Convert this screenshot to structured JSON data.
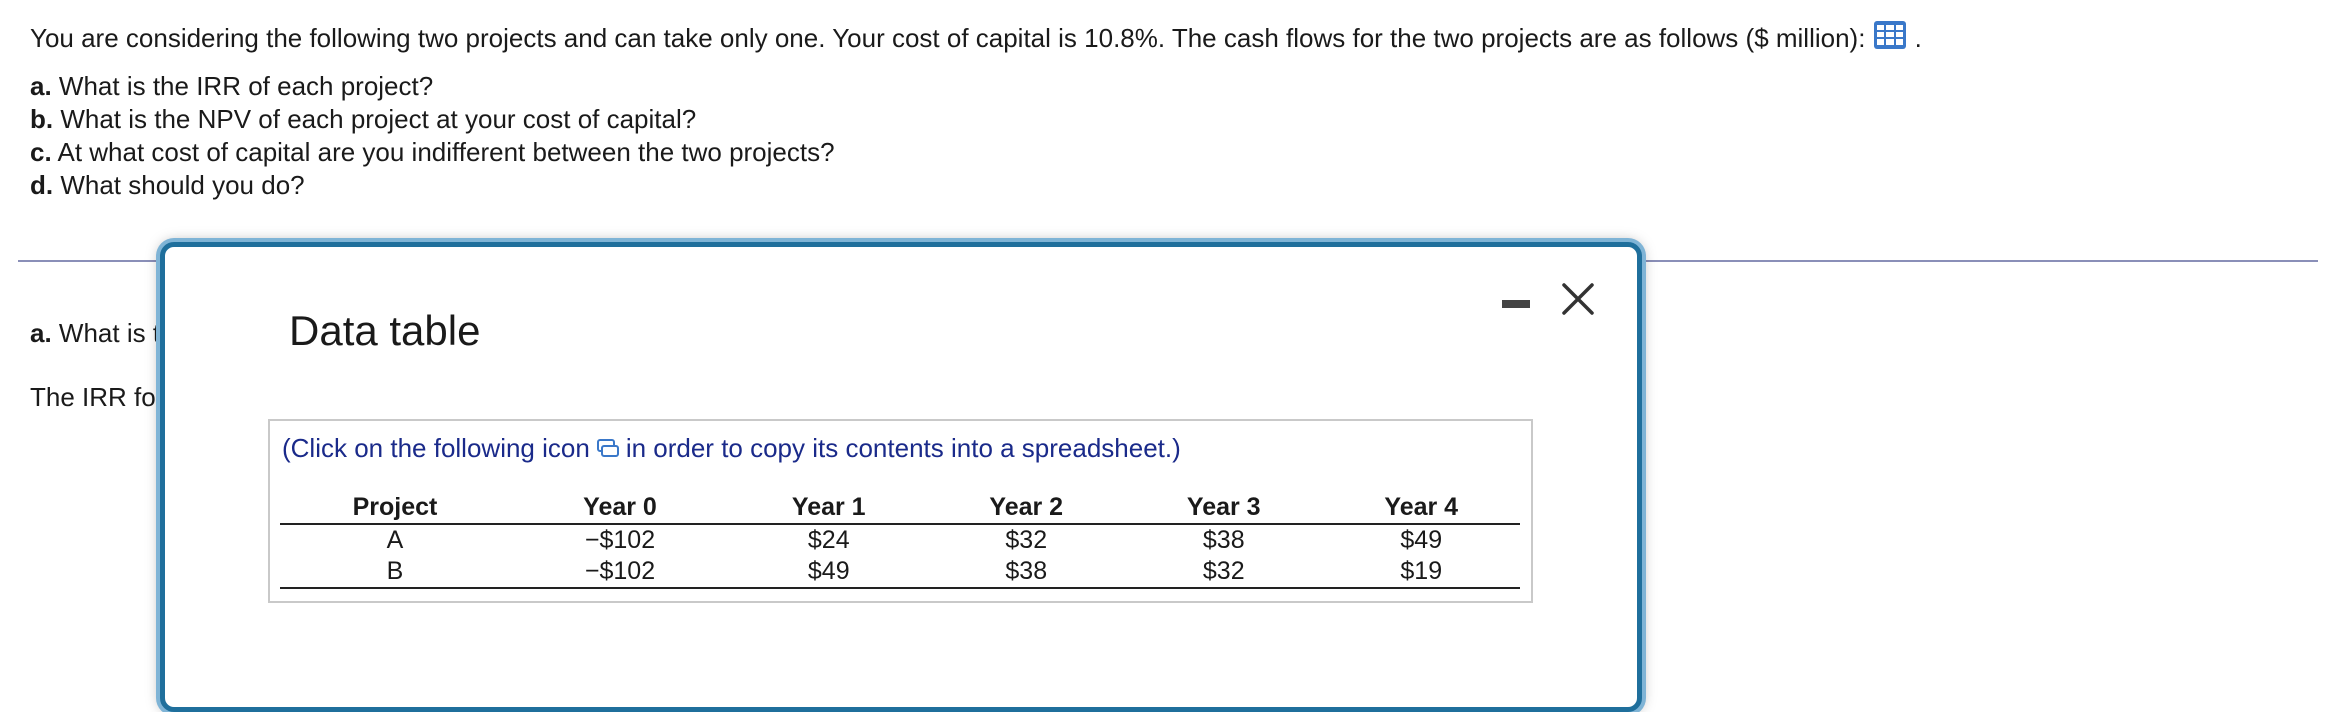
{
  "question": {
    "intro": "You are considering the following two projects and can take only one. Your cost of capital is 10.8%. The cash flows for the two projects are as follows ($ million):",
    "intro_end": ".",
    "parts": [
      {
        "letter": "a.",
        "text": "What is the IRR of each project?"
      },
      {
        "letter": "b.",
        "text": "What is the NPV of each project at your cost of capital?"
      },
      {
        "letter": "c.",
        "text": "At what cost of capital are you indifferent between the two projects?"
      },
      {
        "letter": "d.",
        "text": "What should you do?"
      }
    ]
  },
  "behind": {
    "part_a_letter": "a.",
    "part_a_text": "What is t",
    "irr_text": "The IRR fo"
  },
  "modal": {
    "title": "Data table",
    "copy_note_prefix": "(Click on the following icon",
    "copy_note_suffix": "in order to copy its contents into a spreadsheet.)",
    "table": {
      "headers": [
        "Project",
        "Year 0",
        "Year 1",
        "Year 2",
        "Year 3",
        "Year 4"
      ],
      "rows": [
        [
          "A",
          "−$102",
          "$24",
          "$32",
          "$38",
          "$49"
        ],
        [
          "B",
          "−$102",
          "$49",
          "$38",
          "$32",
          "$19"
        ]
      ]
    }
  },
  "colors": {
    "modal_border": "#1f6f9c",
    "link_text": "#1a2a8a",
    "grid_icon": "#3a78c9"
  }
}
